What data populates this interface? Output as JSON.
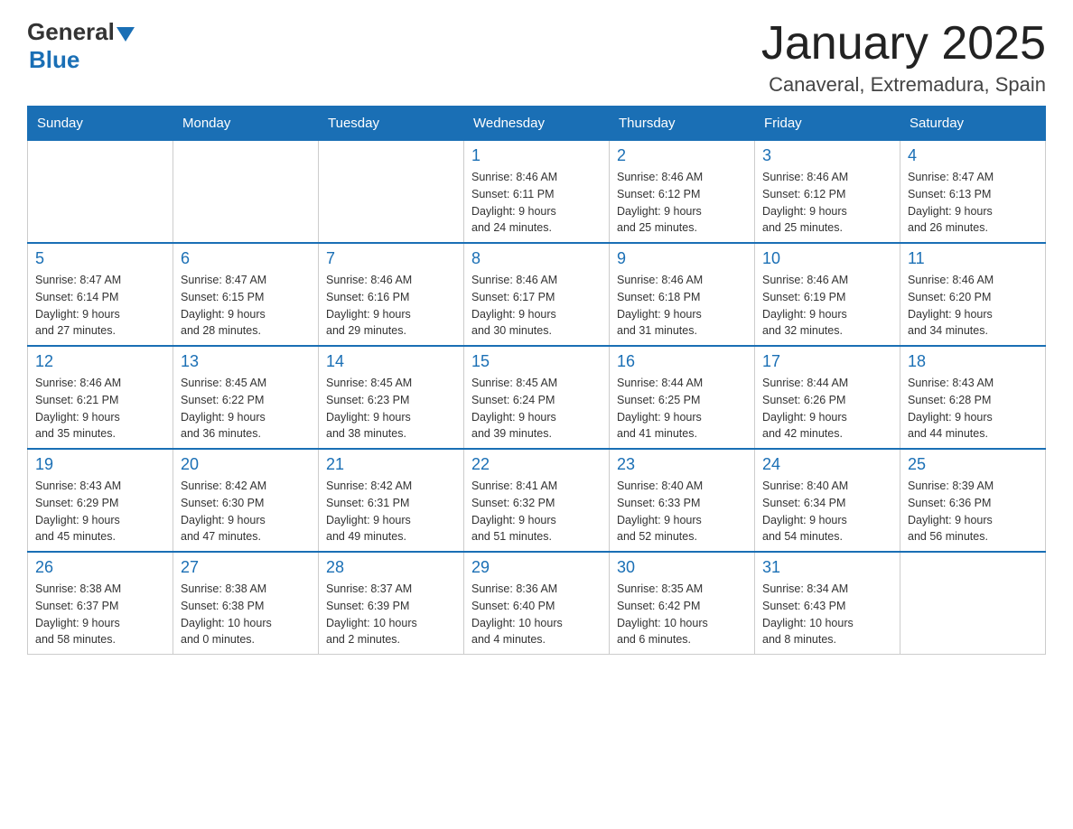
{
  "header": {
    "logo_general": "General",
    "logo_blue": "Blue",
    "month_title": "January 2025",
    "location": "Canaveral, Extremadura, Spain"
  },
  "weekdays": [
    "Sunday",
    "Monday",
    "Tuesday",
    "Wednesday",
    "Thursday",
    "Friday",
    "Saturday"
  ],
  "weeks": [
    [
      {
        "day": "",
        "info": ""
      },
      {
        "day": "",
        "info": ""
      },
      {
        "day": "",
        "info": ""
      },
      {
        "day": "1",
        "info": "Sunrise: 8:46 AM\nSunset: 6:11 PM\nDaylight: 9 hours\nand 24 minutes."
      },
      {
        "day": "2",
        "info": "Sunrise: 8:46 AM\nSunset: 6:12 PM\nDaylight: 9 hours\nand 25 minutes."
      },
      {
        "day": "3",
        "info": "Sunrise: 8:46 AM\nSunset: 6:12 PM\nDaylight: 9 hours\nand 25 minutes."
      },
      {
        "day": "4",
        "info": "Sunrise: 8:47 AM\nSunset: 6:13 PM\nDaylight: 9 hours\nand 26 minutes."
      }
    ],
    [
      {
        "day": "5",
        "info": "Sunrise: 8:47 AM\nSunset: 6:14 PM\nDaylight: 9 hours\nand 27 minutes."
      },
      {
        "day": "6",
        "info": "Sunrise: 8:47 AM\nSunset: 6:15 PM\nDaylight: 9 hours\nand 28 minutes."
      },
      {
        "day": "7",
        "info": "Sunrise: 8:46 AM\nSunset: 6:16 PM\nDaylight: 9 hours\nand 29 minutes."
      },
      {
        "day": "8",
        "info": "Sunrise: 8:46 AM\nSunset: 6:17 PM\nDaylight: 9 hours\nand 30 minutes."
      },
      {
        "day": "9",
        "info": "Sunrise: 8:46 AM\nSunset: 6:18 PM\nDaylight: 9 hours\nand 31 minutes."
      },
      {
        "day": "10",
        "info": "Sunrise: 8:46 AM\nSunset: 6:19 PM\nDaylight: 9 hours\nand 32 minutes."
      },
      {
        "day": "11",
        "info": "Sunrise: 8:46 AM\nSunset: 6:20 PM\nDaylight: 9 hours\nand 34 minutes."
      }
    ],
    [
      {
        "day": "12",
        "info": "Sunrise: 8:46 AM\nSunset: 6:21 PM\nDaylight: 9 hours\nand 35 minutes."
      },
      {
        "day": "13",
        "info": "Sunrise: 8:45 AM\nSunset: 6:22 PM\nDaylight: 9 hours\nand 36 minutes."
      },
      {
        "day": "14",
        "info": "Sunrise: 8:45 AM\nSunset: 6:23 PM\nDaylight: 9 hours\nand 38 minutes."
      },
      {
        "day": "15",
        "info": "Sunrise: 8:45 AM\nSunset: 6:24 PM\nDaylight: 9 hours\nand 39 minutes."
      },
      {
        "day": "16",
        "info": "Sunrise: 8:44 AM\nSunset: 6:25 PM\nDaylight: 9 hours\nand 41 minutes."
      },
      {
        "day": "17",
        "info": "Sunrise: 8:44 AM\nSunset: 6:26 PM\nDaylight: 9 hours\nand 42 minutes."
      },
      {
        "day": "18",
        "info": "Sunrise: 8:43 AM\nSunset: 6:28 PM\nDaylight: 9 hours\nand 44 minutes."
      }
    ],
    [
      {
        "day": "19",
        "info": "Sunrise: 8:43 AM\nSunset: 6:29 PM\nDaylight: 9 hours\nand 45 minutes."
      },
      {
        "day": "20",
        "info": "Sunrise: 8:42 AM\nSunset: 6:30 PM\nDaylight: 9 hours\nand 47 minutes."
      },
      {
        "day": "21",
        "info": "Sunrise: 8:42 AM\nSunset: 6:31 PM\nDaylight: 9 hours\nand 49 minutes."
      },
      {
        "day": "22",
        "info": "Sunrise: 8:41 AM\nSunset: 6:32 PM\nDaylight: 9 hours\nand 51 minutes."
      },
      {
        "day": "23",
        "info": "Sunrise: 8:40 AM\nSunset: 6:33 PM\nDaylight: 9 hours\nand 52 minutes."
      },
      {
        "day": "24",
        "info": "Sunrise: 8:40 AM\nSunset: 6:34 PM\nDaylight: 9 hours\nand 54 minutes."
      },
      {
        "day": "25",
        "info": "Sunrise: 8:39 AM\nSunset: 6:36 PM\nDaylight: 9 hours\nand 56 minutes."
      }
    ],
    [
      {
        "day": "26",
        "info": "Sunrise: 8:38 AM\nSunset: 6:37 PM\nDaylight: 9 hours\nand 58 minutes."
      },
      {
        "day": "27",
        "info": "Sunrise: 8:38 AM\nSunset: 6:38 PM\nDaylight: 10 hours\nand 0 minutes."
      },
      {
        "day": "28",
        "info": "Sunrise: 8:37 AM\nSunset: 6:39 PM\nDaylight: 10 hours\nand 2 minutes."
      },
      {
        "day": "29",
        "info": "Sunrise: 8:36 AM\nSunset: 6:40 PM\nDaylight: 10 hours\nand 4 minutes."
      },
      {
        "day": "30",
        "info": "Sunrise: 8:35 AM\nSunset: 6:42 PM\nDaylight: 10 hours\nand 6 minutes."
      },
      {
        "day": "31",
        "info": "Sunrise: 8:34 AM\nSunset: 6:43 PM\nDaylight: 10 hours\nand 8 minutes."
      },
      {
        "day": "",
        "info": ""
      }
    ]
  ]
}
